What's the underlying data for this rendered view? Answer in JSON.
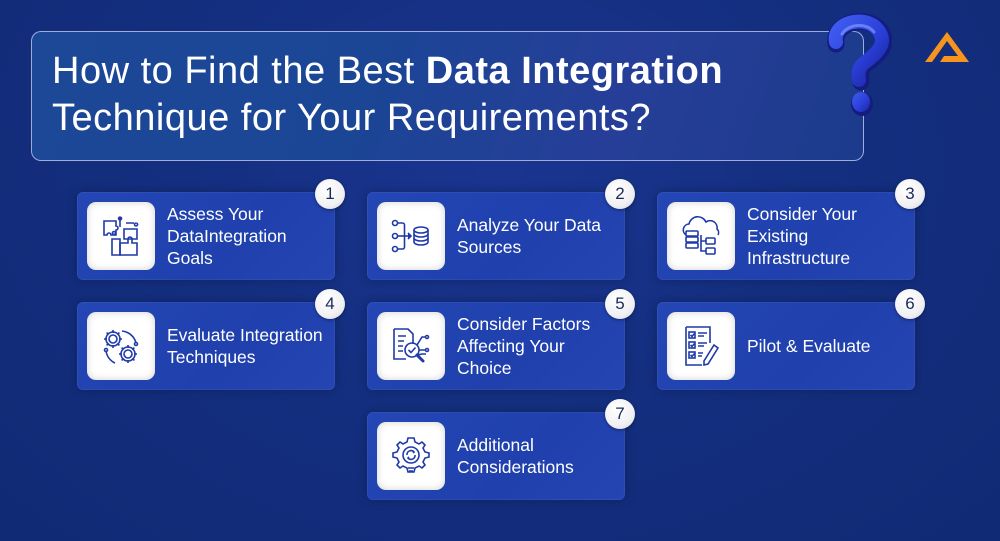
{
  "title": {
    "line1_plain": "How to Find the Best ",
    "line1_bold": "Data Integration",
    "line2": "Technique for Your Requirements?"
  },
  "brand": {
    "logo_icon": "triangle-logo-icon",
    "logo_color": "#f7941d",
    "accent_icon": "question-mark-icon"
  },
  "steps": [
    {
      "number": "1",
      "label": "Assess Your DataIntegration Goals",
      "icon": "puzzle-network-icon"
    },
    {
      "number": "2",
      "label": "Analyze Your Data Sources",
      "icon": "database-merge-icon"
    },
    {
      "number": "3",
      "label": "Consider Your Existing Infrastructure",
      "icon": "cloud-server-icon"
    },
    {
      "number": "4",
      "label": "Evaluate Integration Techniques",
      "icon": "gears-icon"
    },
    {
      "number": "5",
      "label": "Consider Factors Affecting Your Choice",
      "icon": "document-check-search-icon"
    },
    {
      "number": "6",
      "label": "Pilot & Evaluate",
      "icon": "checklist-pen-icon"
    },
    {
      "number": "7",
      "label": "Additional Considerations",
      "icon": "gear-bulb-icon"
    }
  ],
  "colors": {
    "background": "#132d7a",
    "card": "#2144b0",
    "icon_stroke": "#1f3aa8",
    "badge_text": "#1a2a5a"
  }
}
